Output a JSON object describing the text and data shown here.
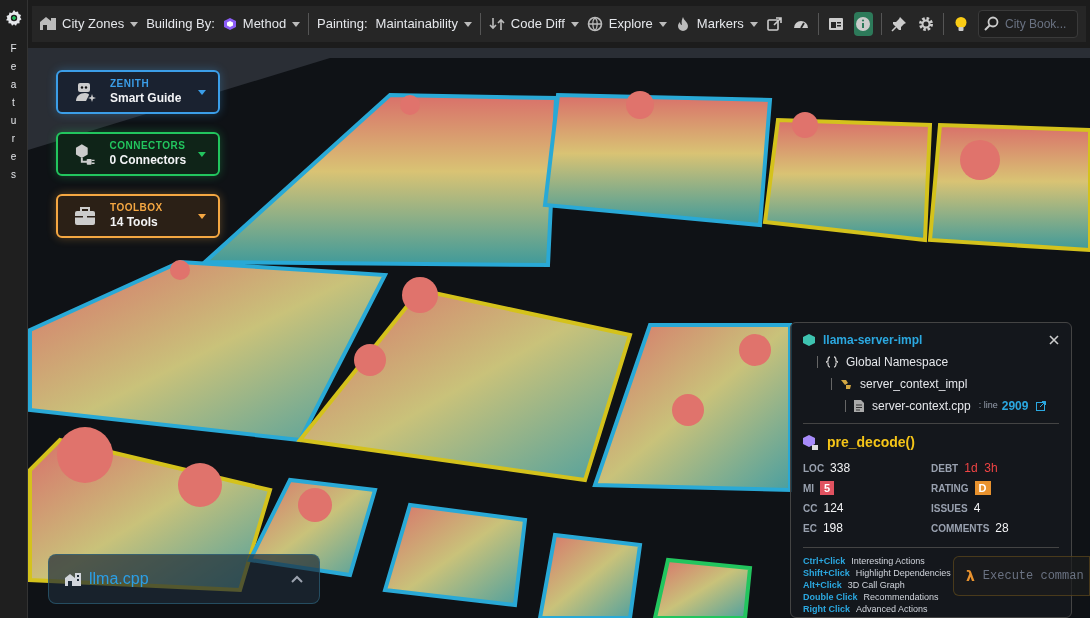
{
  "sidebar": {
    "label": "Features"
  },
  "toolbar": {
    "menus": [
      {
        "label": "City Zones"
      },
      {
        "prefix": "Building By:",
        "label": "Method"
      },
      {
        "prefix": "Painting:",
        "label": "Maintainability"
      },
      {
        "label": "Code Diff"
      },
      {
        "label": "Explore"
      },
      {
        "label": "Markers"
      }
    ],
    "tools": [
      {
        "selected": false
      },
      {
        "selected": false
      },
      {
        "selected": false
      },
      {
        "selected": true
      },
      {
        "selected": false
      },
      {
        "selected": false
      },
      {
        "selected": false
      }
    ],
    "search": {
      "placeholder": "City Book..."
    }
  },
  "cards": [
    {
      "title": "ZENITH",
      "subtitle": "Smart Guide",
      "color": "#3b9ee8"
    },
    {
      "title": "CONNECTORS",
      "subtitle": "0 Connectors",
      "color": "#22c55e"
    },
    {
      "title": "TOOLBOX",
      "subtitle": "14 Tools",
      "color": "#f5a742"
    }
  ],
  "info_panel": {
    "project": "llama-server-impl",
    "namespace": "Global Namespace",
    "class": "server_context_impl",
    "file": "server-context.cpp",
    "line_label": ": line",
    "line": "2909",
    "function": "pre_decode()",
    "metrics_left": [
      {
        "label": "LOC",
        "value": "338",
        "kind": "plain"
      },
      {
        "label": "MI",
        "value": "5",
        "kind": "badge",
        "color": "#e05260"
      },
      {
        "label": "CC",
        "value": "124",
        "kind": "plain"
      },
      {
        "label": "EC",
        "value": "198",
        "kind": "plain"
      }
    ],
    "metrics_right": [
      {
        "label": "DEBT",
        "value": "1d  3h",
        "kind": "alert"
      },
      {
        "label": "RATING",
        "value": "D",
        "kind": "badge",
        "color": "#e8922e"
      },
      {
        "label": "ISSUES",
        "value": "4",
        "kind": "plain"
      },
      {
        "label": "COMMENTS",
        "value": "28",
        "kind": "plain"
      }
    ],
    "hints": [
      {
        "keys": "Ctrl+Click",
        "action": "Interesting Actions"
      },
      {
        "keys": "Shift+Click",
        "action": "Highlight Dependencies"
      },
      {
        "keys": "Alt+Click",
        "action": "3D Call Graph"
      },
      {
        "keys": "Double Click",
        "action": "Recommendations"
      },
      {
        "keys": "Right Click",
        "action": "Advanced Actions"
      }
    ]
  },
  "project_bar": {
    "name": "llma.cpp"
  },
  "command": {
    "prompt": "λ",
    "placeholder": "Execute comman"
  }
}
